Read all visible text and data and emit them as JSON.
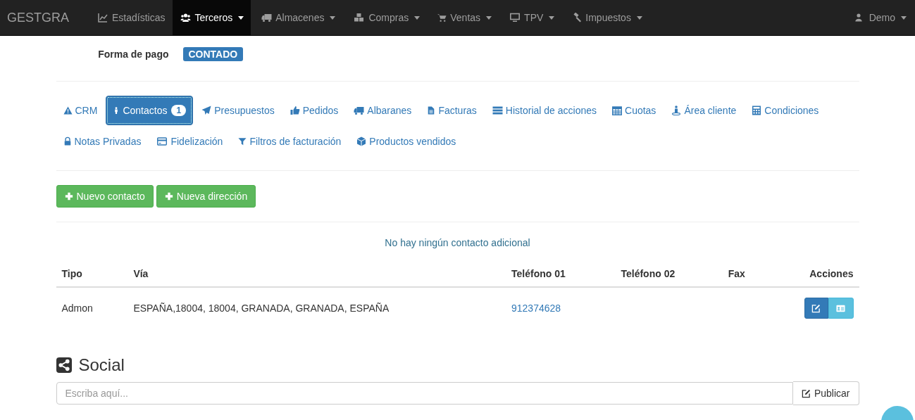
{
  "navbar": {
    "brand": "GESTGRA",
    "items": [
      {
        "label": "Estadísticas",
        "selected": false,
        "dropdown": false
      },
      {
        "label": "Terceros",
        "selected": true,
        "dropdown": true
      },
      {
        "label": "Almacenes",
        "selected": false,
        "dropdown": true
      },
      {
        "label": "Compras",
        "selected": false,
        "dropdown": true
      },
      {
        "label": "Ventas",
        "selected": false,
        "dropdown": true
      },
      {
        "label": "TPV",
        "selected": false,
        "dropdown": true
      },
      {
        "label": "Impuestos",
        "selected": false,
        "dropdown": true
      }
    ],
    "user": {
      "label": "Demo",
      "dropdown": true
    }
  },
  "details": [
    {
      "label": "Forma de pago",
      "value": "CONTADO",
      "color": "#337ab7"
    }
  ],
  "tabs": [
    {
      "label": "CRM",
      "selected": false
    },
    {
      "label": "Contactos",
      "selected": true,
      "badge": "1"
    },
    {
      "label": "Presupuestos",
      "selected": false
    },
    {
      "label": "Pedidos",
      "selected": false
    },
    {
      "label": "Albaranes",
      "selected": false
    },
    {
      "label": "Facturas",
      "selected": false
    },
    {
      "label": "Historial de acciones",
      "selected": false
    },
    {
      "label": "Cuotas",
      "selected": false
    },
    {
      "label": "Área cliente",
      "selected": false
    },
    {
      "label": "Condiciones",
      "selected": false
    },
    {
      "label": "Notas Privadas",
      "selected": false
    },
    {
      "label": "Fidelización",
      "selected": false
    },
    {
      "label": "Filtros de facturación",
      "selected": false
    },
    {
      "label": "Productos vendidos",
      "selected": false
    }
  ],
  "buttons": [
    "Nuevo contacto",
    "Nueva dirección"
  ],
  "notice": "No hay ningún contacto adicional",
  "table": {
    "columns": [
      "Tipo",
      "Vía",
      "Teléfono 01",
      "Teléfono 02",
      "Fax",
      "Acciones"
    ],
    "rows": [
      {
        "tipo": "Admon",
        "via": "ESPAÑA,18004, 18004, GRANADA, GRANADA, ESPAÑA",
        "telefono_01": "912374628"
      }
    ]
  },
  "social": {
    "title": "Social",
    "placeholder": "Escriba aquí...",
    "button": "Publicar"
  }
}
